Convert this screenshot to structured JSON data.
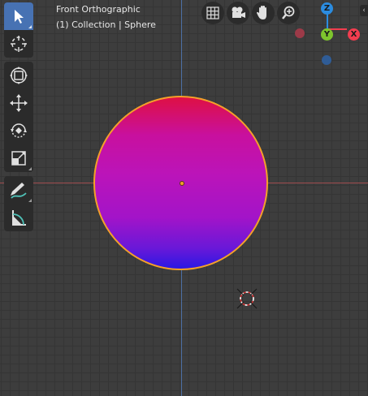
{
  "viewport": {
    "view_name": "Front Orthographic",
    "collection_info": "(1) Collection | Sphere"
  },
  "toolbar": {
    "tools": [
      {
        "name": "select-box",
        "active": true
      },
      {
        "name": "cursor",
        "active": false
      },
      {
        "name": "transform",
        "active": false
      },
      {
        "name": "move",
        "active": false
      },
      {
        "name": "rotate",
        "active": false
      },
      {
        "name": "scale",
        "active": false
      },
      {
        "name": "annotate",
        "active": false
      },
      {
        "name": "measure",
        "active": false
      }
    ]
  },
  "navigation": {
    "buttons": [
      "grid-icon",
      "camera-icon",
      "hand-icon",
      "zoom-icon"
    ]
  },
  "gizmo": {
    "z_label": "Z",
    "y_label": "Y",
    "x_label": "X",
    "colors": {
      "x": "#f23d4f",
      "y": "#7ec52d",
      "z": "#2b8ce0"
    }
  },
  "colors": {
    "selection_outline": "#f4a02a",
    "active_tool": "#4772b3",
    "x_axis": "#a04c4f",
    "z_axis": "#4c6fa4"
  }
}
